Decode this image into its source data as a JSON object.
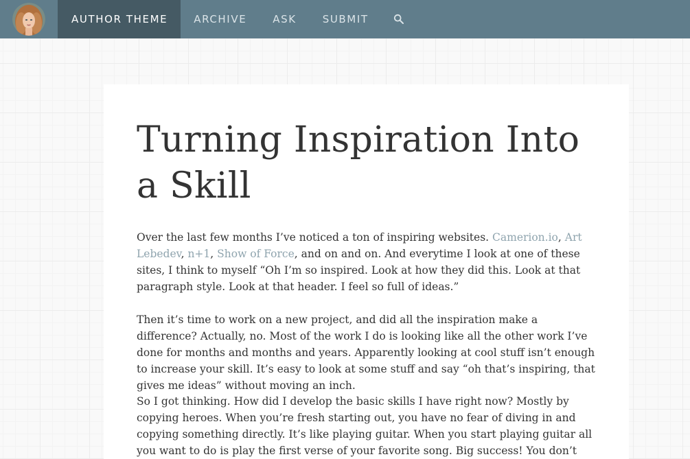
{
  "nav": {
    "items": [
      {
        "label": "AUTHOR THEME"
      },
      {
        "label": "ARCHIVE"
      },
      {
        "label": "ASK"
      },
      {
        "label": "SUBMIT"
      }
    ],
    "search_icon": "search-icon",
    "avatar_icon": "avatar",
    "colors": {
      "bar": "#607d8b",
      "active": "#455a64",
      "link": "#8fa4ae"
    }
  },
  "post": {
    "title": "Turning Inspiration Into a Skill",
    "p1": {
      "t1": "Over the last few months I’ve noticed a ton of inspiring websites. ",
      "link1": "Camerion.io",
      "sep1": ", ",
      "link2": "Art Lebedev",
      "sep2": ", ",
      "link3": "n+1",
      "sep3": ", ",
      "link4": "Show of Force",
      "t2": ", and on and on. And everytime I look at one of these sites, I think to myself “Oh I’m so inspired. Look at how they did this. Look at that paragraph style. Look at that header. I feel so full of ideas.”"
    },
    "p2": "Then it’s time to work on a new project, and did all the inspiration make a difference? Actually, no. Most of the work I do is looking like all the other work I’ve done for months and months and years. Apparently looking at cool stuff isn’t enough to increase your skill. It’s easy to look at some stuff and say “oh that’s inspiring, that gives me ideas” without moving an inch.",
    "p3": "So I got thinking. How did I develop the basic skills I have right now? Mostly by copying heroes. When you’re fresh starting out, you have no fear of diving in and copying something directly. It’s like playing guitar. When you start playing guitar all you want to do is play the first verse of your favorite song. Big success! You don’t need to write the next great guitar"
  }
}
